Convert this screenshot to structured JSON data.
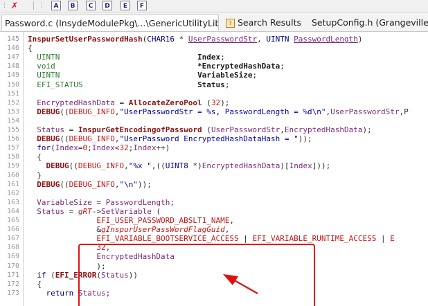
{
  "toolbar": {
    "buttons": [
      "A",
      "B",
      "C",
      "D",
      "E",
      "F"
    ]
  },
  "tabs": [
    {
      "label": "Password.c (InsydeModulePkg\\...\\GenericUtilityLib)",
      "active": true
    },
    {
      "label": "Search Results",
      "active": false,
      "icon": "?"
    },
    {
      "label": "SetupConfig.h (GrangevilleM",
      "active": false
    }
  ],
  "code": {
    "lines": [
      {
        "n": "145",
        "html": "<span class=\"f\">InspurSetUserPasswordHash</span>(<span class=\"k\">CHAR16</span> * <span class=\"p u\">UserPasswordStr</span>, <span class=\"k\">UINTN</span> <span class=\"p u\">PasswordLength</span>)"
      },
      {
        "n": "146",
        "html": "{"
      },
      {
        "n": "147",
        "html": "  <span class=\"n\">UINTN</span>                              <span class=\"dk\">Index</span>;"
      },
      {
        "n": "148",
        "html": "  <span class=\"n\">void</span>                               <span class=\"dk\">*EncryptedHashData</span>;"
      },
      {
        "n": "149",
        "html": "  <span class=\"n\">UINTN</span>                              <span class=\"dk\">VariableSize</span>;"
      },
      {
        "n": "150",
        "html": "  <span class=\"n\">EFI_STATUS</span>                         <span class=\"dk\">Status</span>;"
      },
      {
        "n": "151",
        "html": ""
      },
      {
        "n": "152",
        "html": "  <span class=\"p\">EncryptedHashData</span> = <span class=\"f\">AllocateZeroPool</span> (<span class=\"m\">32</span>);"
      },
      {
        "n": "153",
        "html": "  <span class=\"f\">DEBUG</span>((<span class=\"m\">DEBUG_INFO</span>,<span class=\"s\">\"UserPasswordStr = %s, PasswordLength = %d\\n\"</span>,<span class=\"p\">UserPasswordStr</span>,P"
      },
      {
        "n": "154",
        "html": ""
      },
      {
        "n": "155",
        "html": "  <span class=\"p\">Status</span> = <span class=\"f\">InspurGetEncodingofPassword</span> (<span class=\"p\">UserPasswordStr</span>,<span class=\"p\">EncryptedHashData</span>);"
      },
      {
        "n": "156",
        "html": "  <span class=\"f\">DEBUG</span>((<span class=\"m\">DEBUG_INFO</span>,<span class=\"s\">\"UserPassword EncryptedHashDataHash = \"</span>));"
      },
      {
        "n": "157",
        "html": "  <span class=\"k\">for</span>(<span class=\"p\">Index</span>=<span class=\"m\">0</span>;<span class=\"p\">Index</span>&lt;<span class=\"m\">32</span>;<span class=\"p\">Index</span>++)"
      },
      {
        "n": "158",
        "html": "  {"
      },
      {
        "n": "159",
        "html": "    <span class=\"f\">DEBUG</span>((<span class=\"m\">DEBUG_INFO</span>,<span class=\"s\">\"%x \"</span>,((<span class=\"k\">UINT8</span> *)<span class=\"p\">EncryptedHashData</span>)[<span class=\"p\">Index</span>]));"
      },
      {
        "n": "160",
        "html": "  }"
      },
      {
        "n": "161",
        "html": "  <span class=\"f\">DEBUG</span>((<span class=\"m\">DEBUG_INFO</span>,<span class=\"s\">\"\\n\"</span>));"
      },
      {
        "n": "162",
        "html": ""
      },
      {
        "n": "163",
        "html": "  <span class=\"p\">VariableSize</span> = <span class=\"p\">PasswordLength</span>;"
      },
      {
        "n": "164",
        "html": "  <span class=\"p\">Status</span> = <span class=\"m i\">gRT</span>-&gt;<span class=\"p\">SetVariable</span> ("
      },
      {
        "n": "165",
        "html": "               <span class=\"m\">EFI_USER_PASSWORD_ABSLT1_NAME</span>,"
      },
      {
        "n": "166",
        "html": "               &amp;<span class=\"m i\">gInspurUserPassWordFlagGuid</span>,"
      },
      {
        "n": "167",
        "html": "               <span class=\"m\">EFI_VARIABLE_BOOTSERVICE_ACCESS</span> | <span class=\"m\">EFI_VARIABLE_RUNTIME_ACCESS</span> | <span class=\"m\">E</span>"
      },
      {
        "n": "168",
        "html": "               <span class=\"m\">32</span>,"
      },
      {
        "n": "169",
        "html": "               <span class=\"p\">EncryptedHashData</span>"
      },
      {
        "n": "170",
        "html": "               );"
      },
      {
        "n": "171",
        "html": "  <span class=\"k\">if</span> (<span class=\"f\">EFI_ERROR</span>(<span class=\"p\">Status</span>))"
      },
      {
        "n": "172",
        "html": "  {"
      },
      {
        "n": "173",
        "html": "    <span class=\"k\">return</span> <span class=\"p\">Status</span>;"
      }
    ]
  },
  "colors": {
    "annotation": "#e01010"
  }
}
